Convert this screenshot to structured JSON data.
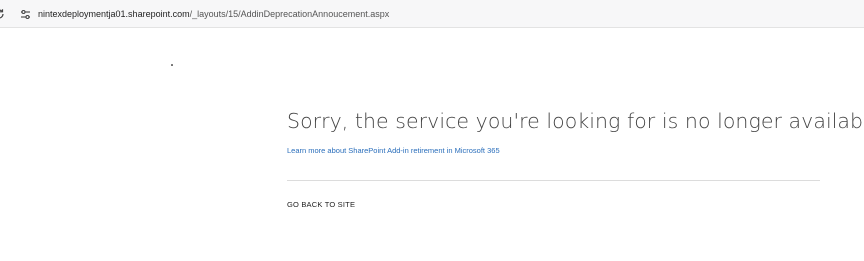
{
  "browser": {
    "url_host": "nintexdeploymentja01.sharepoint.com",
    "url_path": "/_layouts/15/AddinDeprecationAnnoucement.aspx"
  },
  "page": {
    "headline": "Sorry, the service you're looking for is no longer available.",
    "learn_more_link": "Learn more about SharePoint Add-in retirement in Microsoft 365",
    "back_link": "GO BACK TO SITE"
  },
  "colors": {
    "link": "#2a6ebb",
    "headline": "#444444",
    "divider": "#dcdcdc"
  }
}
